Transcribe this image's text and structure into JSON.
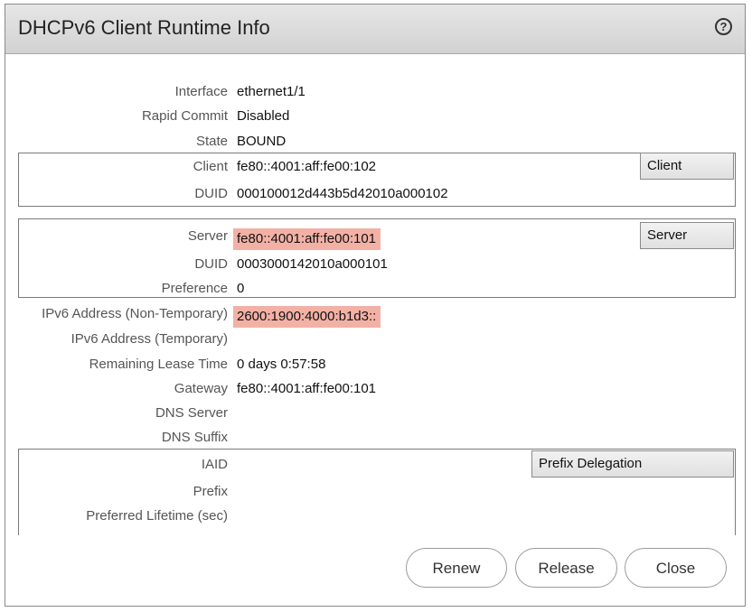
{
  "dialog": {
    "title": "DHCPv6 Client Runtime Info",
    "help_icon": "?"
  },
  "fields": {
    "interface": {
      "label": "Interface",
      "value": "ethernet1/1"
    },
    "rapid_commit": {
      "label": "Rapid Commit",
      "value": "Disabled"
    },
    "state": {
      "label": "State",
      "value": "BOUND"
    },
    "ipv6_non_temp": {
      "label": "IPv6 Address (Non-Temporary)",
      "value": "2600:1900:4000:b1d3::"
    },
    "ipv6_temp": {
      "label": "IPv6 Address (Temporary)",
      "value": ""
    },
    "remaining_lease": {
      "label": "Remaining Lease Time",
      "value": "0 days 0:57:58"
    },
    "gateway": {
      "label": "Gateway",
      "value": "fe80::4001:aff:fe00:101"
    },
    "dns_server": {
      "label": "DNS Server",
      "value": ""
    },
    "dns_suffix": {
      "label": "DNS Suffix",
      "value": ""
    }
  },
  "client_group": {
    "tag": "Client",
    "client": {
      "label": "Client",
      "value": "fe80::4001:aff:fe00:102"
    },
    "duid": {
      "label": "DUID",
      "value": "000100012d443b5d42010a000102"
    }
  },
  "server_group": {
    "tag": "Server",
    "server": {
      "label": "Server",
      "value": "fe80::4001:aff:fe00:101"
    },
    "duid": {
      "label": "DUID",
      "value": "0003000142010a000101"
    },
    "preference": {
      "label": "Preference",
      "value": "0"
    }
  },
  "prefix_group": {
    "tag": "Prefix Delegation",
    "iaid": {
      "label": "IAID",
      "value": ""
    },
    "prefix": {
      "label": "Prefix",
      "value": ""
    },
    "preferred_lifetime": {
      "label": "Preferred Lifetime (sec)",
      "value": ""
    }
  },
  "buttons": {
    "renew": "Renew",
    "release": "Release",
    "close": "Close"
  },
  "colors": {
    "highlight": "#f3b1a6",
    "titlebar": "#d9d9d9"
  }
}
